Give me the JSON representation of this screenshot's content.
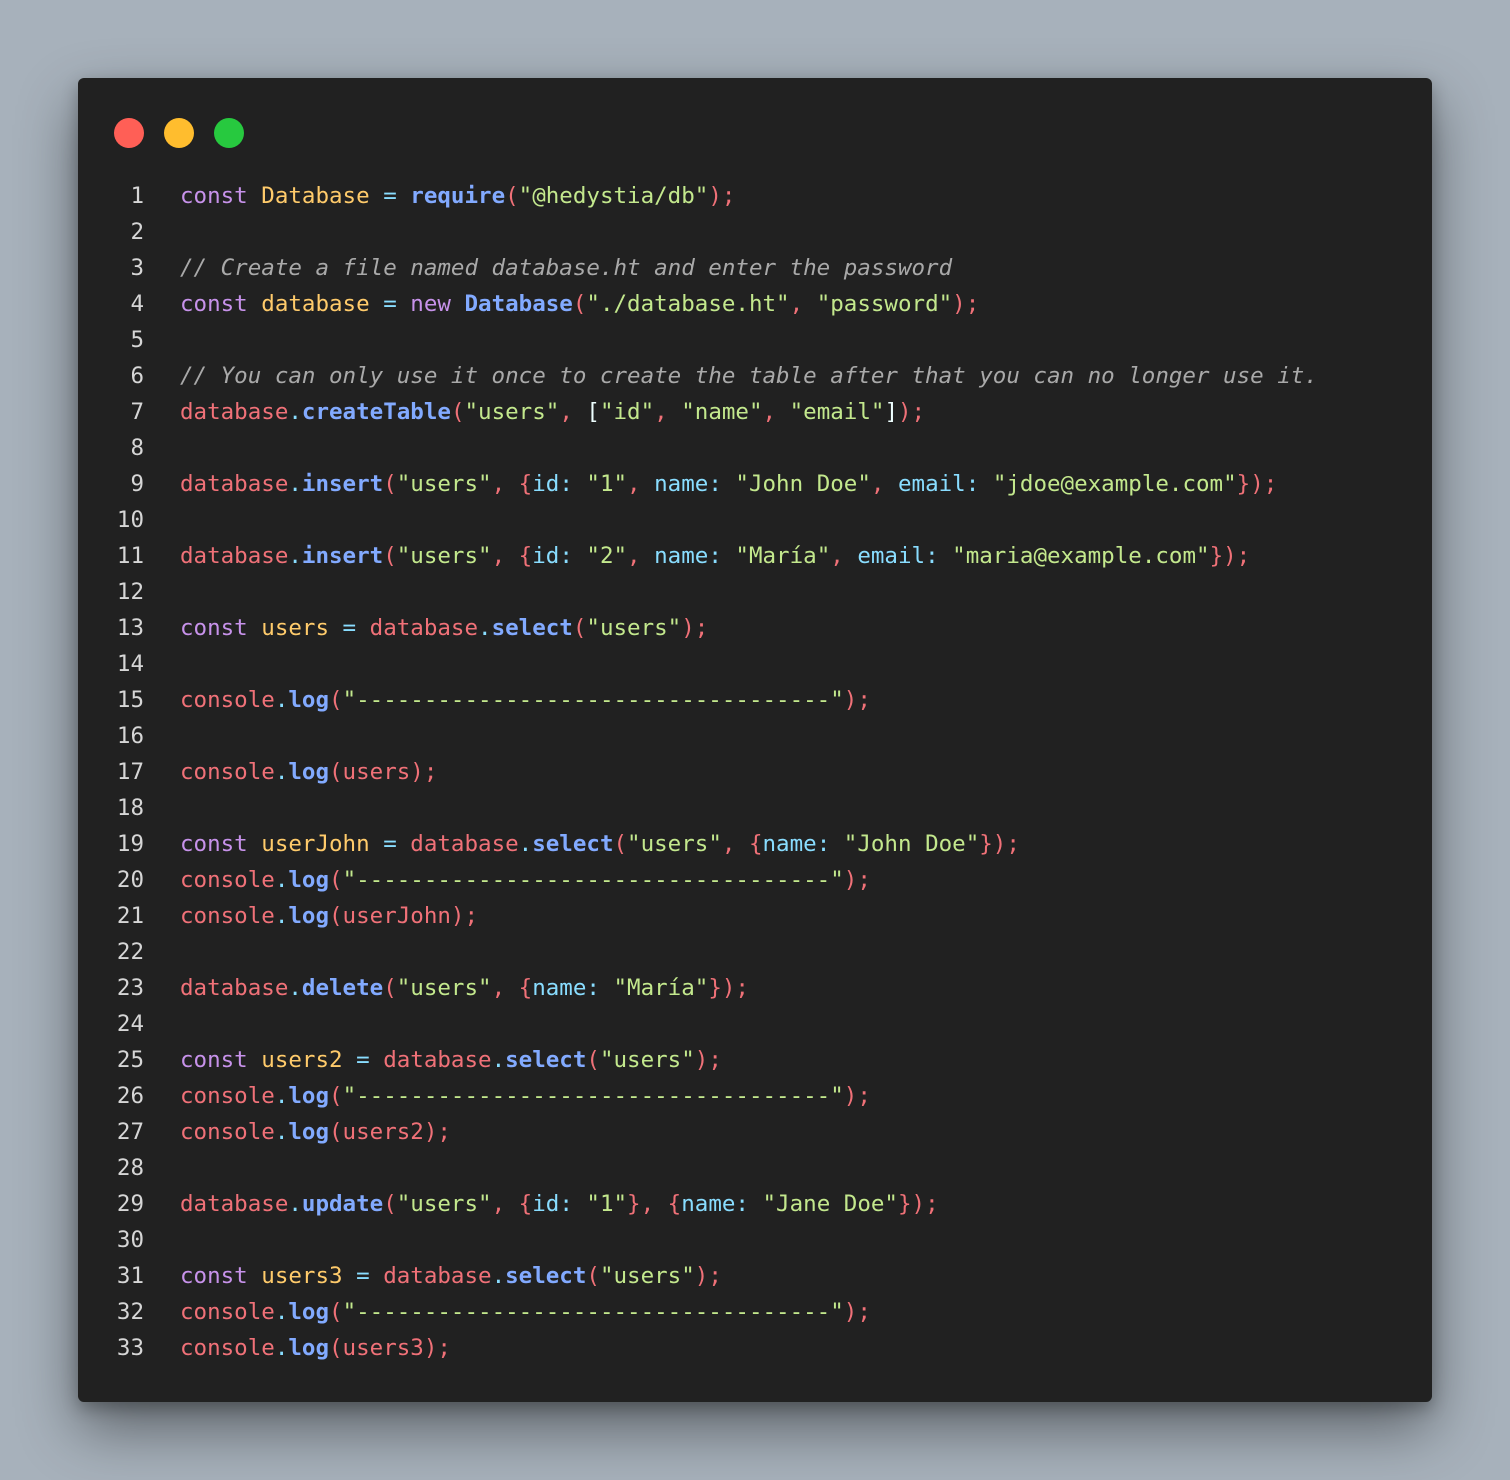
{
  "window": {
    "controls": [
      "close",
      "minimize",
      "maximize"
    ],
    "colors": {
      "close": "#ff5f56",
      "minimize": "#ffbd2e",
      "maximize": "#27c93f",
      "background": "#212121"
    }
  },
  "editor": {
    "language": "javascript",
    "lines": [
      [
        [
          "kw",
          "const "
        ],
        [
          "cls",
          "Database"
        ],
        [
          "pun",
          " = "
        ],
        [
          "fn",
          "require"
        ],
        [
          "pl",
          "("
        ],
        [
          "str",
          "\"@hedystia/db\""
        ],
        [
          "pl",
          ");"
        ]
      ],
      [],
      [
        [
          "com",
          "// Create a file named database.ht and enter the password"
        ]
      ],
      [
        [
          "kw",
          "const "
        ],
        [
          "cls",
          "database"
        ],
        [
          "pun",
          " = "
        ],
        [
          "kw",
          "new "
        ],
        [
          "fn",
          "Database"
        ],
        [
          "pl",
          "("
        ],
        [
          "str",
          "\"./database.ht\""
        ],
        [
          "pl",
          ", "
        ],
        [
          "str",
          "\"password\""
        ],
        [
          "pl",
          ");"
        ]
      ],
      [],
      [
        [
          "com",
          "// You can only use it once to create the table after that you can no longer use it."
        ]
      ],
      [
        [
          "obj",
          "database"
        ],
        [
          "pun",
          "."
        ],
        [
          "fn",
          "createTable"
        ],
        [
          "pl",
          "("
        ],
        [
          "str",
          "\"users\""
        ],
        [
          "pl",
          ", "
        ],
        [
          "pln",
          "["
        ],
        [
          "str",
          "\"id\""
        ],
        [
          "pl",
          ", "
        ],
        [
          "str",
          "\"name\""
        ],
        [
          "pl",
          ", "
        ],
        [
          "str",
          "\"email\""
        ],
        [
          "pln",
          "]"
        ],
        [
          "pl",
          ");"
        ]
      ],
      [],
      [
        [
          "obj",
          "database"
        ],
        [
          "pun",
          "."
        ],
        [
          "fn",
          "insert"
        ],
        [
          "pl",
          "("
        ],
        [
          "str",
          "\"users\""
        ],
        [
          "pl",
          ", {"
        ],
        [
          "prop",
          "id"
        ],
        [
          "pun",
          ": "
        ],
        [
          "str",
          "\"1\""
        ],
        [
          "pl",
          ", "
        ],
        [
          "prop",
          "name"
        ],
        [
          "pun",
          ": "
        ],
        [
          "str",
          "\"John Doe\""
        ],
        [
          "pl",
          ", "
        ],
        [
          "prop",
          "email"
        ],
        [
          "pun",
          ": "
        ],
        [
          "str",
          "\"jdoe@example.com\""
        ],
        [
          "pl",
          "});"
        ]
      ],
      [],
      [
        [
          "obj",
          "database"
        ],
        [
          "pun",
          "."
        ],
        [
          "fn",
          "insert"
        ],
        [
          "pl",
          "("
        ],
        [
          "str",
          "\"users\""
        ],
        [
          "pl",
          ", {"
        ],
        [
          "prop",
          "id"
        ],
        [
          "pun",
          ": "
        ],
        [
          "str",
          "\"2\""
        ],
        [
          "pl",
          ", "
        ],
        [
          "prop",
          "name"
        ],
        [
          "pun",
          ": "
        ],
        [
          "str",
          "\"María\""
        ],
        [
          "pl",
          ", "
        ],
        [
          "prop",
          "email"
        ],
        [
          "pun",
          ": "
        ],
        [
          "str",
          "\"maria@example.com\""
        ],
        [
          "pl",
          "});"
        ]
      ],
      [],
      [
        [
          "kw",
          "const "
        ],
        [
          "cls",
          "users"
        ],
        [
          "pun",
          " = "
        ],
        [
          "obj",
          "database"
        ],
        [
          "pun",
          "."
        ],
        [
          "fn",
          "select"
        ],
        [
          "pl",
          "("
        ],
        [
          "str",
          "\"users\""
        ],
        [
          "pl",
          ");"
        ]
      ],
      [],
      [
        [
          "obj",
          "console"
        ],
        [
          "pun",
          "."
        ],
        [
          "fn",
          "log"
        ],
        [
          "pl",
          "("
        ],
        [
          "str",
          "\"-----------------------------------\""
        ],
        [
          "pl",
          ");"
        ]
      ],
      [],
      [
        [
          "obj",
          "console"
        ],
        [
          "pun",
          "."
        ],
        [
          "fn",
          "log"
        ],
        [
          "pl",
          "(users);"
        ]
      ],
      [],
      [
        [
          "kw",
          "const "
        ],
        [
          "cls",
          "userJohn"
        ],
        [
          "pun",
          " = "
        ],
        [
          "obj",
          "database"
        ],
        [
          "pun",
          "."
        ],
        [
          "fn",
          "select"
        ],
        [
          "pl",
          "("
        ],
        [
          "str",
          "\"users\""
        ],
        [
          "pl",
          ", {"
        ],
        [
          "prop",
          "name"
        ],
        [
          "pun",
          ": "
        ],
        [
          "str",
          "\"John Doe\""
        ],
        [
          "pl",
          "});"
        ]
      ],
      [
        [
          "obj",
          "console"
        ],
        [
          "pun",
          "."
        ],
        [
          "fn",
          "log"
        ],
        [
          "pl",
          "("
        ],
        [
          "str",
          "\"-----------------------------------\""
        ],
        [
          "pl",
          ");"
        ]
      ],
      [
        [
          "obj",
          "console"
        ],
        [
          "pun",
          "."
        ],
        [
          "fn",
          "log"
        ],
        [
          "pl",
          "(userJohn);"
        ]
      ],
      [],
      [
        [
          "obj",
          "database"
        ],
        [
          "pun",
          "."
        ],
        [
          "fn",
          "delete"
        ],
        [
          "pl",
          "("
        ],
        [
          "str",
          "\"users\""
        ],
        [
          "pl",
          ", {"
        ],
        [
          "prop",
          "name"
        ],
        [
          "pun",
          ": "
        ],
        [
          "str",
          "\"María\""
        ],
        [
          "pl",
          "});"
        ]
      ],
      [],
      [
        [
          "kw",
          "const "
        ],
        [
          "cls",
          "users2"
        ],
        [
          "pun",
          " = "
        ],
        [
          "obj",
          "database"
        ],
        [
          "pun",
          "."
        ],
        [
          "fn",
          "select"
        ],
        [
          "pl",
          "("
        ],
        [
          "str",
          "\"users\""
        ],
        [
          "pl",
          ");"
        ]
      ],
      [
        [
          "obj",
          "console"
        ],
        [
          "pun",
          "."
        ],
        [
          "fn",
          "log"
        ],
        [
          "pl",
          "("
        ],
        [
          "str",
          "\"-----------------------------------\""
        ],
        [
          "pl",
          ");"
        ]
      ],
      [
        [
          "obj",
          "console"
        ],
        [
          "pun",
          "."
        ],
        [
          "fn",
          "log"
        ],
        [
          "pl",
          "(users2);"
        ]
      ],
      [],
      [
        [
          "obj",
          "database"
        ],
        [
          "pun",
          "."
        ],
        [
          "fn",
          "update"
        ],
        [
          "pl",
          "("
        ],
        [
          "str",
          "\"users\""
        ],
        [
          "pl",
          ", {"
        ],
        [
          "prop",
          "id"
        ],
        [
          "pun",
          ": "
        ],
        [
          "str",
          "\"1\""
        ],
        [
          "pl",
          "}, {"
        ],
        [
          "prop",
          "name"
        ],
        [
          "pun",
          ": "
        ],
        [
          "str",
          "\"Jane Doe\""
        ],
        [
          "pl",
          "});"
        ]
      ],
      [],
      [
        [
          "kw",
          "const "
        ],
        [
          "cls",
          "users3"
        ],
        [
          "pun",
          " = "
        ],
        [
          "obj",
          "database"
        ],
        [
          "pun",
          "."
        ],
        [
          "fn",
          "select"
        ],
        [
          "pl",
          "("
        ],
        [
          "str",
          "\"users\""
        ],
        [
          "pl",
          ");"
        ]
      ],
      [
        [
          "obj",
          "console"
        ],
        [
          "pun",
          "."
        ],
        [
          "fn",
          "log"
        ],
        [
          "pl",
          "("
        ],
        [
          "str",
          "\"-----------------------------------\""
        ],
        [
          "pl",
          ");"
        ]
      ],
      [
        [
          "obj",
          "console"
        ],
        [
          "pun",
          "."
        ],
        [
          "fn",
          "log"
        ],
        [
          "pl",
          "(users3);"
        ]
      ]
    ]
  }
}
